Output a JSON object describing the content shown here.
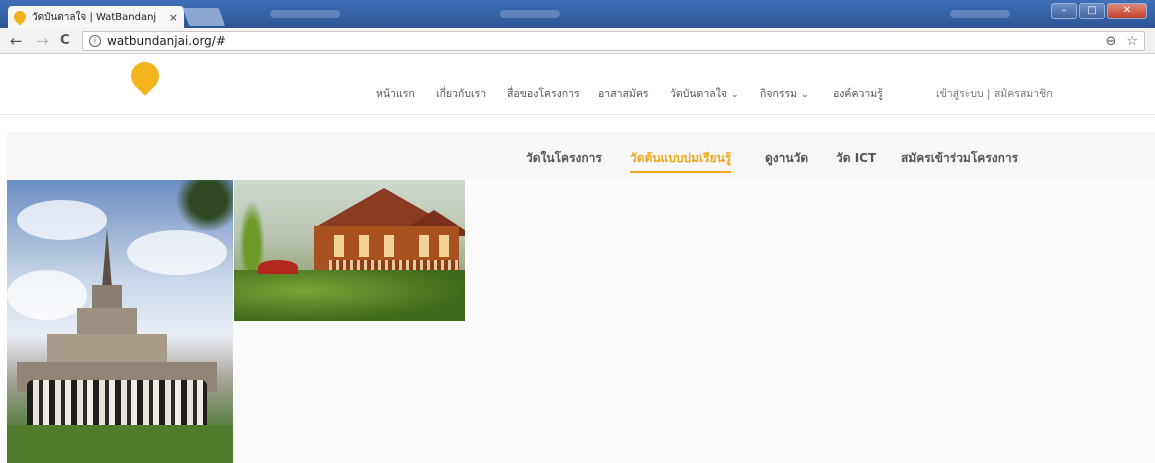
{
  "browser": {
    "tab_title": "วัดบันดาลใจ | WatBandanj",
    "tab_close": "×",
    "url": "watbundanjai.org/#",
    "back_glyph": "←",
    "forward_glyph": "→",
    "reload_glyph": "C",
    "info_glyph": "i",
    "zoom_glyph": "⊖",
    "star_glyph": "☆",
    "min_glyph": "–",
    "max_glyph": "□",
    "close_glyph": "✕"
  },
  "header": {
    "nav": [
      {
        "label": "หน้าแรก",
        "chevron": ""
      },
      {
        "label": "เกี่ยวกับเรา",
        "chevron": ""
      },
      {
        "label": "สื่อของโครงการ",
        "chevron": ""
      },
      {
        "label": "อาสาสมัคร",
        "chevron": ""
      },
      {
        "label": "วัดบันดาลใจ",
        "chevron": "⌄"
      },
      {
        "label": "กิจกรรม",
        "chevron": "⌄"
      },
      {
        "label": "องค์ความรู้",
        "chevron": ""
      }
    ],
    "account": "เข้าสู่ระบบ | สมัครสมาชิก"
  },
  "subnav": {
    "items": [
      {
        "label": "วัดในโครงการ",
        "active": false
      },
      {
        "label": "วัดต้นแบบบ่มเรียนรู้",
        "active": true
      },
      {
        "label": "ดูงานวัด",
        "active": false
      },
      {
        "label": "วัด ICT",
        "active": false
      },
      {
        "label": "สมัครเข้าร่วมโครงการ",
        "active": false
      }
    ]
  },
  "colors": {
    "accent": "#f0a81c",
    "titlebar": "#2c5598"
  },
  "icons": {
    "logo": "bodhi-leaf-icon"
  }
}
